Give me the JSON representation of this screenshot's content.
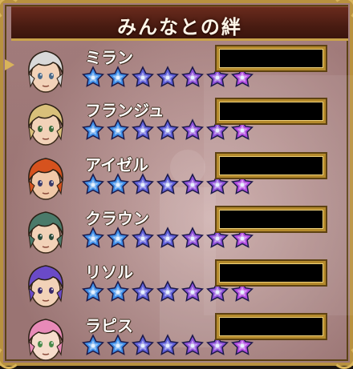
{
  "title": "みんなとの絆",
  "colors": {
    "frame": "#b8913f",
    "title_bg": "#4a1c12",
    "star_blue": "#3f8ee8",
    "star_indigo": "#5f5fd8",
    "star_violet": "#8c4fd8",
    "star_purple": "#b04ae0"
  },
  "cursor_icon": "triangle-pointer-icon",
  "characters": [
    {
      "name": "ミラン",
      "hair": "#d9d9d9",
      "skin": "#f2d2b8",
      "eyes": "#4a6a8a",
      "stars": 7,
      "bond": null
    },
    {
      "name": "フランジュ",
      "hair": "#d9c07a",
      "skin": "#f2d2b8",
      "eyes": "#3a6a3a",
      "stars": 7,
      "bond": null
    },
    {
      "name": "アイゼル",
      "hair": "#d6521e",
      "skin": "#f0c8a8",
      "eyes": "#3a3a6a",
      "stars": 7,
      "bond": null
    },
    {
      "name": "クラウン",
      "hair": "#4a7a6a",
      "skin": "#f2d2b8",
      "eyes": "#2a4a3a",
      "stars": 7,
      "bond": null
    },
    {
      "name": "リソル",
      "hair": "#6a4ac8",
      "skin": "#f2d2b8",
      "eyes": "#3a2a6a",
      "stars": 7,
      "bond": null
    },
    {
      "name": "ラピス",
      "hair": "#e88ab8",
      "skin": "#f6dccc",
      "eyes": "#4a8a4a",
      "stars": 7,
      "bond": null
    }
  ]
}
